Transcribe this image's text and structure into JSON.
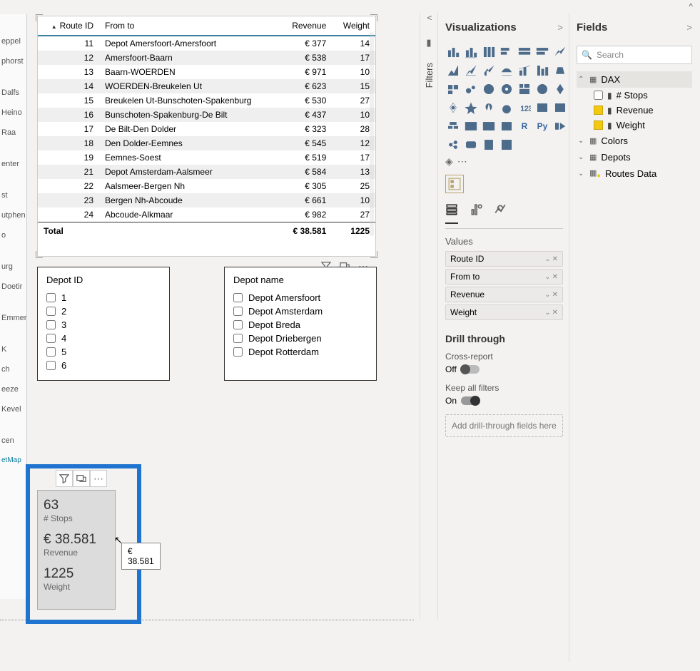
{
  "top_caret": "^",
  "map_labels": [
    "",
    "eppel",
    "phorst",
    "",
    "Dalfs",
    "Heino",
    "Raa",
    "",
    "enter",
    "",
    "st",
    "utphen",
    "o",
    "",
    "urg",
    "Doetir",
    "",
    "Emmer",
    "",
    "K",
    "ch",
    "eeze",
    "Kevel",
    "",
    "cen"
  ],
  "map_link": "etMap",
  "table": {
    "headers": [
      "Route ID",
      "From to",
      "Revenue",
      "Weight"
    ],
    "rows": [
      {
        "id": "11",
        "ft": "Depot Amersfoort-Amersfoort",
        "rev": "€ 377",
        "w": "14"
      },
      {
        "id": "12",
        "ft": "Amersfoort-Baarn",
        "rev": "€ 538",
        "w": "17"
      },
      {
        "id": "13",
        "ft": "Baarn-WOERDEN",
        "rev": "€ 971",
        "w": "10"
      },
      {
        "id": "14",
        "ft": "WOERDEN-Breukelen Ut",
        "rev": "€ 623",
        "w": "15"
      },
      {
        "id": "15",
        "ft": "Breukelen Ut-Bunschoten-Spakenburg",
        "rev": "€ 530",
        "w": "27"
      },
      {
        "id": "16",
        "ft": "Bunschoten-Spakenburg-De Bilt",
        "rev": "€ 437",
        "w": "10"
      },
      {
        "id": "17",
        "ft": "De Bilt-Den Dolder",
        "rev": "€ 323",
        "w": "28"
      },
      {
        "id": "18",
        "ft": "Den Dolder-Eemnes",
        "rev": "€ 545",
        "w": "12"
      },
      {
        "id": "19",
        "ft": "Eemnes-Soest",
        "rev": "€ 519",
        "w": "17"
      },
      {
        "id": "21",
        "ft": "Depot Amsterdam-Aalsmeer",
        "rev": "€ 584",
        "w": "13"
      },
      {
        "id": "22",
        "ft": "Aalsmeer-Bergen Nh",
        "rev": "€ 305",
        "w": "25"
      },
      {
        "id": "23",
        "ft": "Bergen Nh-Abcoude",
        "rev": "€ 661",
        "w": "10"
      },
      {
        "id": "24",
        "ft": "Abcoude-Alkmaar",
        "rev": "€ 982",
        "w": "27"
      }
    ],
    "total_label": "Total",
    "total_rev": "€ 38.581",
    "total_w": "1225"
  },
  "slicer_id": {
    "title": "Depot ID",
    "items": [
      "1",
      "2",
      "3",
      "4",
      "5",
      "6"
    ]
  },
  "slicer_name": {
    "title": "Depot name",
    "items": [
      "Depot Amersfoort",
      "Depot Amsterdam",
      "Depot Breda",
      "Depot Driebergen",
      "Depot Rotterdam"
    ]
  },
  "card": {
    "metrics": [
      {
        "val": "63",
        "lbl": "# Stops"
      },
      {
        "val": "€ 38.581",
        "lbl": "Revenue"
      },
      {
        "val": "1225",
        "lbl": "Weight"
      }
    ],
    "tooltip": "€ 38.581"
  },
  "filters_label": "Filters",
  "viz": {
    "title": "Visualizations",
    "values_label": "Values",
    "wells": [
      "Route ID",
      "From to",
      "Revenue",
      "Weight"
    ],
    "drill_title": "Drill through",
    "cross_label": "Cross-report",
    "cross_state": "Off",
    "keep_label": "Keep all filters",
    "keep_state": "On",
    "drop_hint": "Add drill-through fields here"
  },
  "fields": {
    "title": "Fields",
    "search_ph": "Search",
    "tables": [
      {
        "name": "DAX",
        "expanded": true,
        "cols": [
          {
            "name": "# Stops",
            "checked": false
          },
          {
            "name": "Revenue",
            "checked": true
          },
          {
            "name": "Weight",
            "checked": true
          }
        ]
      },
      {
        "name": "Colors",
        "expanded": false
      },
      {
        "name": "Depots",
        "expanded": false
      },
      {
        "name": "Routes Data",
        "expanded": false,
        "special": true
      }
    ]
  }
}
